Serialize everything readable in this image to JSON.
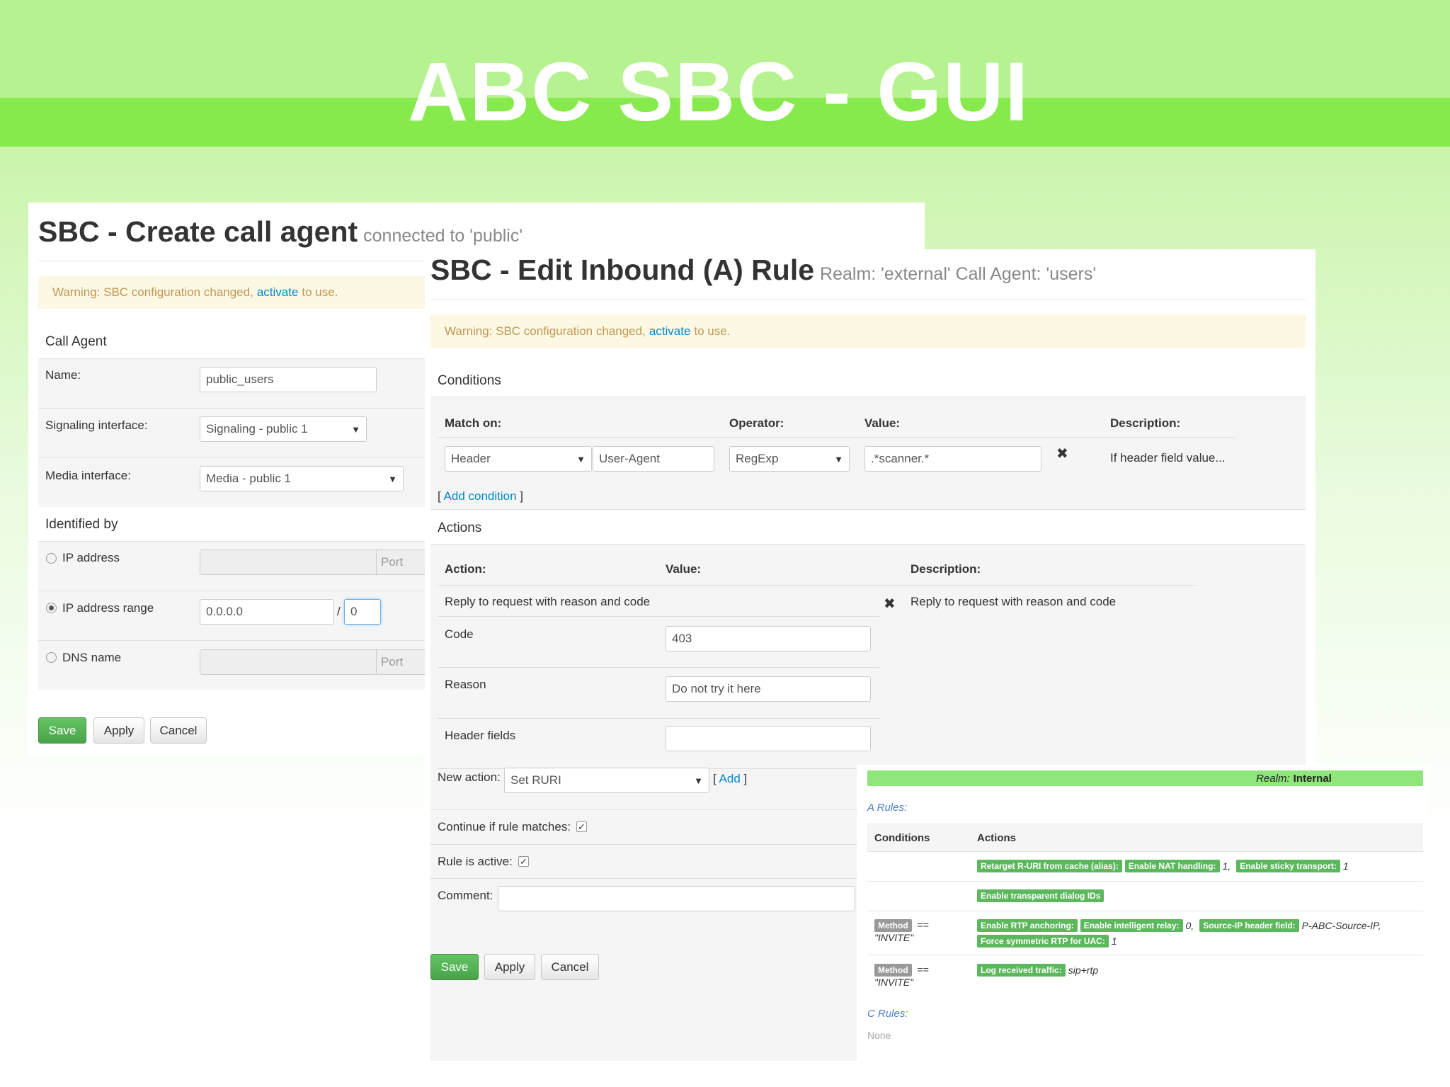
{
  "slide": {
    "title": "ABC SBC - GUI"
  },
  "create_agent": {
    "title": "SBC - Create call agent",
    "subtitle": "connected to 'public'",
    "warning": {
      "before": "Warning: SBC configuration changed,",
      "link": "activate",
      "after": "to use."
    },
    "section_call_agent": "Call Agent",
    "name_label": "Name:",
    "name_value": "public_users",
    "signaling_label": "Signaling interface:",
    "signaling_value": "Signaling - public 1",
    "media_label": "Media interface:",
    "media_value": "Media - public 1",
    "section_identified": "Identified by",
    "ip_address_label": "IP address",
    "port_placeholder": "Port",
    "ip_range_label": "IP address range",
    "ip_range_value": "0.0.0.0",
    "slash": "/",
    "mask_value": "0",
    "dns_label": "DNS name",
    "save": "Save",
    "apply": "Apply",
    "cancel": "Cancel"
  },
  "edit_rule": {
    "title": "SBC - Edit Inbound (A) Rule",
    "subtitle": "Realm: 'external' Call Agent: 'users'",
    "warning": {
      "before": "Warning: SBC configuration changed,",
      "link": "activate",
      "after": "to use."
    },
    "conditions_title": "Conditions",
    "cond_headers": {
      "match_on": "Match on:",
      "operator": "Operator:",
      "value": "Value:",
      "description": "Description:"
    },
    "condition": {
      "match_type": "Header",
      "header_name": "User-Agent",
      "operator": "RegExp",
      "value": ".*scanner.*",
      "description": "If header field value..."
    },
    "bracket_open": "[",
    "bracket_close": "]",
    "add_condition": "Add condition",
    "actions_title": "Actions",
    "act_headers": {
      "action": "Action:",
      "value": "Value:",
      "description": "Description:"
    },
    "action": {
      "name": "Reply to request with reason and code",
      "description": "Reply to request with reason and code",
      "code_label": "Code",
      "code_value": "403",
      "reason_label": "Reason",
      "reason_value": "Do not try it here",
      "header_fields_label": "Header fields",
      "header_fields_value": ""
    },
    "new_action_label": "New action:",
    "new_action_value": "Set RURI",
    "add": "Add",
    "continue_label": "Continue if rule matches:",
    "active_label": "Rule is active:",
    "comment_label": "Comment:",
    "comment_value": "",
    "save": "Save",
    "apply": "Apply",
    "cancel": "Cancel"
  },
  "realm_overview": {
    "realm_prefix": "Realm:",
    "realm_name": "Internal",
    "a_rules": "A Rules:",
    "headers": {
      "conditions": "Conditions",
      "actions": "Actions"
    },
    "rows": [
      {
        "tags": [
          "Retarget R-URI from cache (alias):",
          "Enable NAT handling:",
          "Enable sticky transport:"
        ],
        "values": [
          "",
          "1,",
          "1"
        ]
      },
      {
        "tags": [
          "Enable transparent dialog IDs"
        ]
      },
      {
        "cond_tag": "Method",
        "cond_op": "==",
        "cond_value": "\"INVITE\"",
        "line1_tags": [
          "Enable RTP anchoring:",
          "Enable intelligent relay:",
          "Source-IP header field:"
        ],
        "line1_values": [
          "",
          "0,",
          "P-ABC-Source-IP,"
        ],
        "line2_tag": "Force symmetric RTP for UAC:",
        "line2_value": "1"
      },
      {
        "cond_tag": "Method",
        "cond_op": "==",
        "cond_value": "\"INVITE\"",
        "tag": "Log received traffic:",
        "value": "sip+rtp"
      }
    ],
    "c_rules": "C Rules:",
    "none": "None"
  }
}
